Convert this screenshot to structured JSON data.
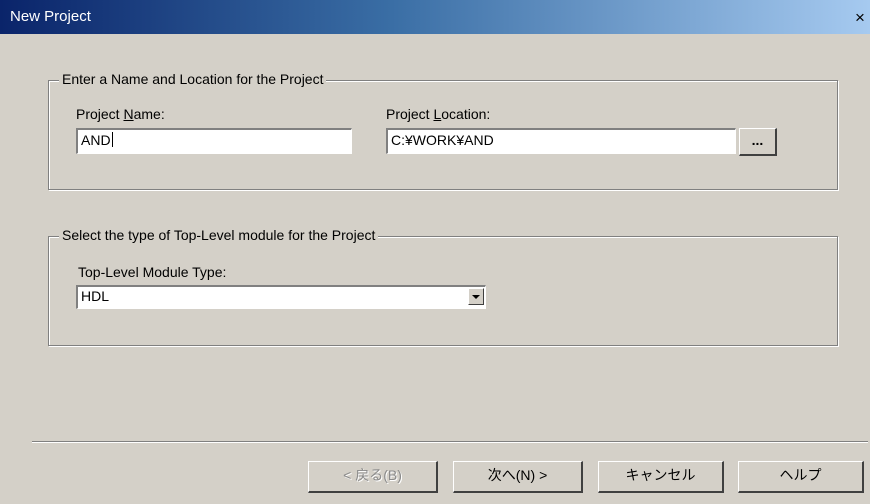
{
  "window": {
    "title": "New Project",
    "close_glyph": "×"
  },
  "name_location_group": {
    "title": "Enter a Name and Location for the Project",
    "project_name_label_pre": "Project ",
    "project_name_label_accel": "N",
    "project_name_label_post": "ame:",
    "project_name_value": "AND",
    "project_location_label_pre": "Project ",
    "project_location_label_accel": "L",
    "project_location_label_post": "ocation:",
    "project_location_value": "C:¥WORK¥AND",
    "browse_label": "..."
  },
  "module_group": {
    "title": "Select the type of Top-Level module for the Project",
    "module_type_label": "Top-Level Module Type:",
    "module_type_value": "HDL"
  },
  "buttons": {
    "back": "< 戻る(B)",
    "next": "次へ(N) >",
    "cancel": "キャンセル",
    "help": "ヘルプ"
  }
}
